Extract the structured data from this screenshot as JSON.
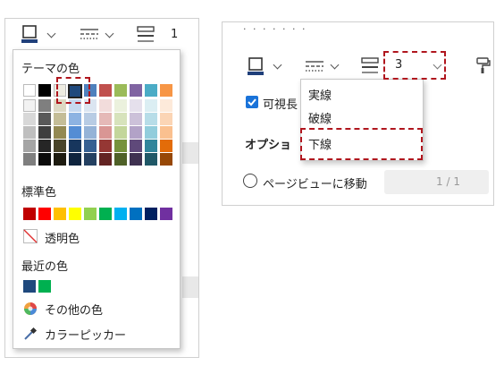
{
  "left_panel": {
    "toolbar": {
      "line_width_value": "1"
    },
    "popup": {
      "theme_colors_label": "テーマの色",
      "standard_colors_label": "標準色",
      "transparent_label": "透明色",
      "recent_colors_label": "最近の色",
      "more_colors_label": "その他の色",
      "picker_label": "カラーピッカー",
      "theme_top_row": [
        "#ffffff",
        "#000000",
        "#eeece1",
        "#1f497d",
        "#4f81bd",
        "#c0504d",
        "#9bbb59",
        "#8064a2",
        "#4bacc6",
        "#f79646"
      ],
      "theme_shades": [
        [
          "#f2f2f2",
          "#7f7f7f",
          "#ddd9c3",
          "#c6d9f0",
          "#dbe5f1",
          "#f2dcdb",
          "#ebf1dd",
          "#e5e0ec",
          "#dbeef3",
          "#fdeada"
        ],
        [
          "#d8d8d8",
          "#595959",
          "#c4bd97",
          "#8db3e2",
          "#b8cce4",
          "#e5b9b7",
          "#d7e3bc",
          "#ccc1d9",
          "#b7dde8",
          "#fbd5b5"
        ],
        [
          "#bfbfbf",
          "#3f3f3f",
          "#938953",
          "#548dd4",
          "#95b3d7",
          "#d99694",
          "#c3d69b",
          "#b2a2c7",
          "#92cddc",
          "#fac08f"
        ],
        [
          "#a5a5a5",
          "#262626",
          "#494429",
          "#17365d",
          "#366092",
          "#953734",
          "#76923c",
          "#5f497a",
          "#31859b",
          "#e36c09"
        ],
        [
          "#7f7f7f",
          "#0c0c0c",
          "#1d1b10",
          "#0f243e",
          "#244061",
          "#632423",
          "#4f6128",
          "#3f3151",
          "#205867",
          "#974806"
        ]
      ],
      "standard_colors": [
        "#c00000",
        "#ff0000",
        "#ffc000",
        "#ffff00",
        "#92d050",
        "#00b050",
        "#00b0f0",
        "#0070c0",
        "#002060",
        "#7030a0"
      ],
      "recent_colors": [
        "#1f497d",
        "#00b050"
      ]
    }
  },
  "right_panel": {
    "top_text": "· · · ·  · · ·",
    "size_value": "3",
    "checkbox_label": "可視長",
    "options_label": "オプショ",
    "goto_page_label": "ページビューに移動",
    "page_counter": "1 / 1",
    "dropdown_items": [
      "実線",
      "破線",
      "下線"
    ]
  }
}
